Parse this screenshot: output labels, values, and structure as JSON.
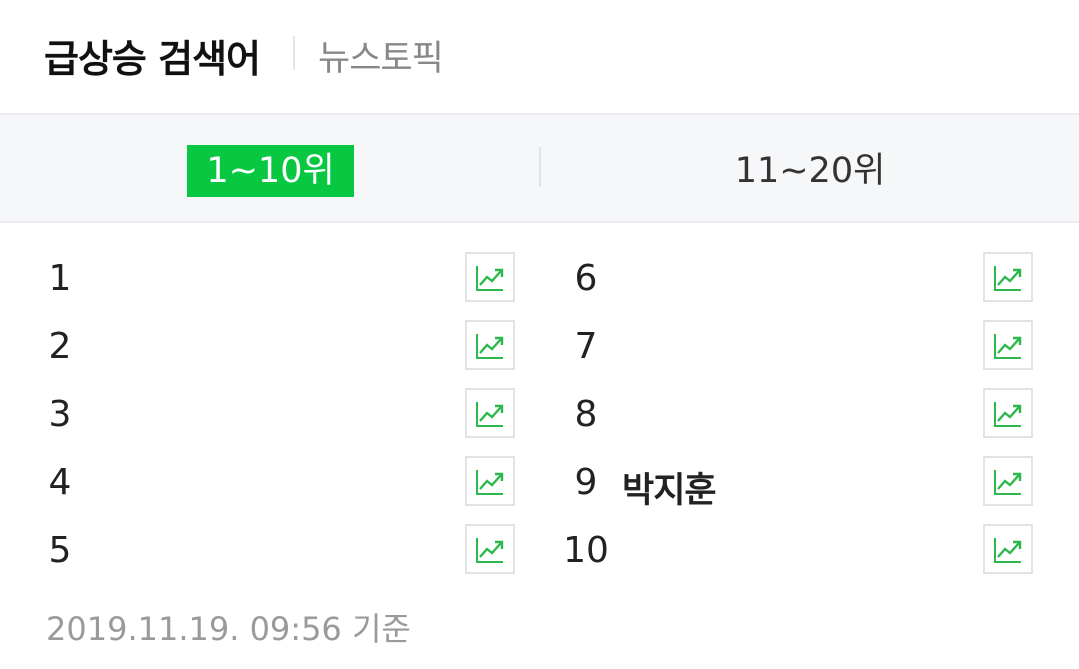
{
  "header": {
    "title": "급상승 검색어",
    "news_tab": "뉴스토픽"
  },
  "tabs": [
    {
      "label": "1~10위",
      "active": true
    },
    {
      "label": "11~20위",
      "active": false
    }
  ],
  "rankings_left": [
    {
      "rank": "1",
      "keyword": ""
    },
    {
      "rank": "2",
      "keyword": ""
    },
    {
      "rank": "3",
      "keyword": ""
    },
    {
      "rank": "4",
      "keyword": ""
    },
    {
      "rank": "5",
      "keyword": ""
    }
  ],
  "rankings_right": [
    {
      "rank": "6",
      "keyword": ""
    },
    {
      "rank": "7",
      "keyword": ""
    },
    {
      "rank": "8",
      "keyword": ""
    },
    {
      "rank": "9",
      "keyword": "박지훈"
    },
    {
      "rank": "10",
      "keyword": ""
    }
  ],
  "trend_icon": "trend-chart-icon",
  "footer": {
    "timestamp": "2019.11.19. 09:56 기준"
  },
  "colors": {
    "accent": "#07c840",
    "trend_icon": "#2db84b"
  }
}
